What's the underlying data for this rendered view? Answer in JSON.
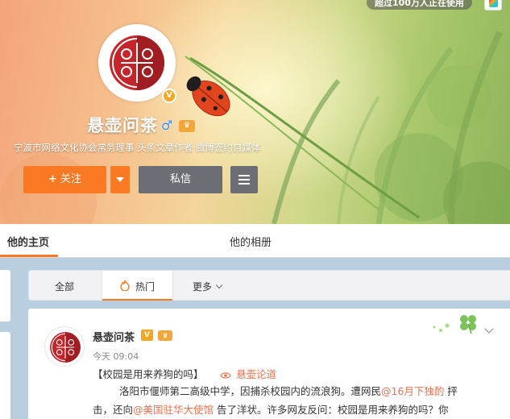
{
  "top_badge": {
    "text": "超过100万人正在使用"
  },
  "profile": {
    "name": "悬壶问茶",
    "gender_symbol": "♂",
    "verified_symbol": "V",
    "member_symbol": "♛",
    "bio": "宁波市网络文化协会常务理事 头条文章作者 微博签约自媒体"
  },
  "actions": {
    "follow_plus": "+",
    "follow_label": "关注",
    "message_label": "私信"
  },
  "nav_tabs": [
    {
      "label": "他的主页"
    },
    {
      "label": "他的相册"
    }
  ],
  "filters": {
    "all": "全部",
    "hot": "热门",
    "more": "更多"
  },
  "post": {
    "author": "悬壶问茶",
    "verified_symbol": "V",
    "member_symbol": "♛",
    "time": "今天 09:04",
    "topic": "【校园是用来养狗的吗】",
    "tag": "悬壶论道",
    "line1_text": "洛阳市偃师第二高级中学，因捕杀校园内的流浪狗。遭网民",
    "line1_mention": "@16月下独酌",
    "line1_tail": " 抨",
    "line2_head": "击，还向",
    "line2_mention": "@美国驻华大使馆",
    "line2_tail": " 告了洋状。许多网友反问：校园是用来养狗的吗？你"
  },
  "colors": {
    "accent_orange": "#f97a22",
    "link": "#eb7350",
    "gray_button": "#6b6e74",
    "page_bg": "#b9cfe0"
  },
  "icons": {
    "follow": "plus-icon",
    "dropdown": "caret-down-icon",
    "more_menu": "hamburger-icon",
    "hot": "fire-icon",
    "more_filter": "chevron-down-icon",
    "tag": "eye-icon",
    "card_menu": "chevron-down-icon",
    "decoration": "clover-icon"
  }
}
